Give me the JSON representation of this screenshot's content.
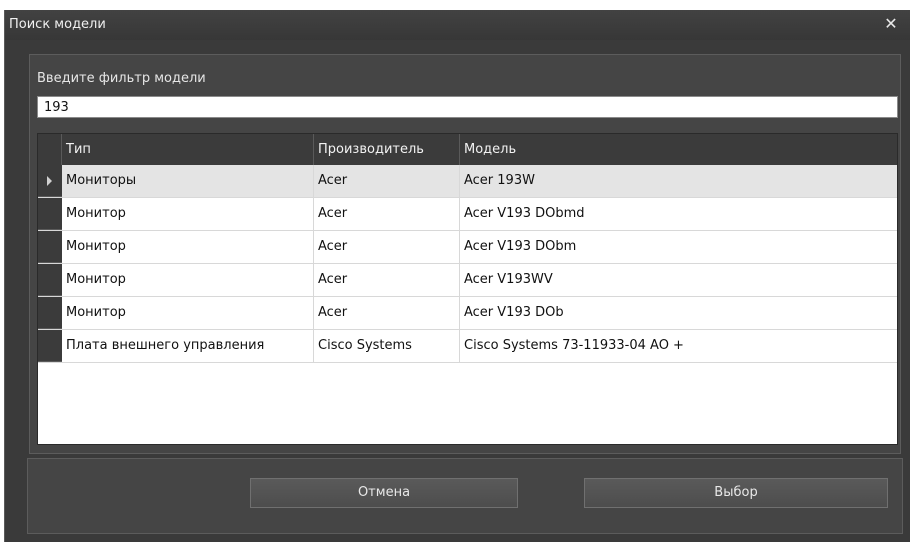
{
  "window": {
    "title": "Поиск модели",
    "close_glyph": "✕"
  },
  "filter": {
    "label": "Введите фильтр модели",
    "value": "193"
  },
  "grid": {
    "columns": [
      "Тип",
      "Производитель",
      "Модель"
    ],
    "rows": [
      {
        "type": "Мониторы",
        "vendor": "Acer",
        "model": "Acer 193W"
      },
      {
        "type": "Монитор",
        "vendor": "Acer",
        "model": "Acer V193 DObmd"
      },
      {
        "type": "Монитор",
        "vendor": "Acer",
        "model": "Acer V193 DObm"
      },
      {
        "type": "Монитор",
        "vendor": "Acer",
        "model": "Acer V193WV"
      },
      {
        "type": "Монитор",
        "vendor": "Acer",
        "model": "Acer V193 DOb"
      },
      {
        "type": "Плата внешнего управления",
        "vendor": "Cisco Systems",
        "model": "Cisco Systems 73-11933-04 AO +"
      }
    ],
    "selected_row": 0
  },
  "buttons": {
    "cancel_label": "Отмена",
    "select_label": "Выбор"
  },
  "colors": {
    "window_bg": "#3a3a3a",
    "panel_bg": "#454545",
    "header_bg": "#3b3b3b",
    "selected_row_bg": "#e4e4e4"
  },
  "icons": {
    "close": "close-icon",
    "row_indicator": "row-pointer-icon"
  }
}
